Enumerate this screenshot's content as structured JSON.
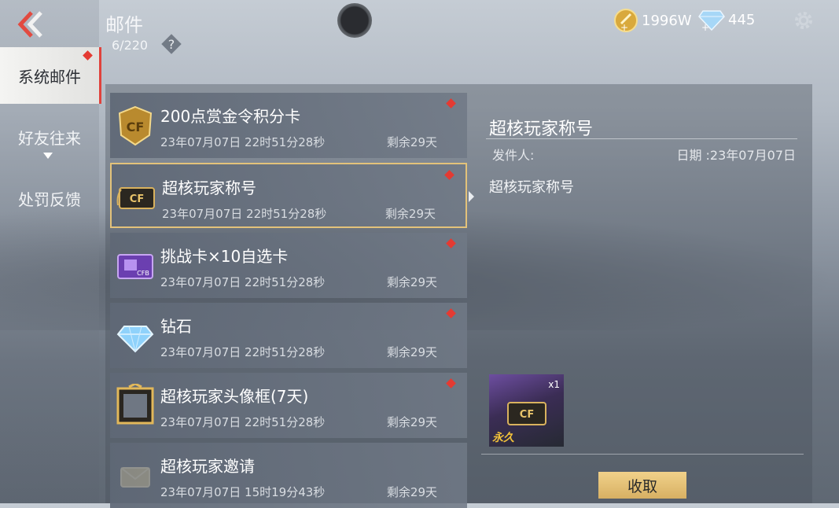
{
  "header": {
    "back_icon": "back-chevron-icon",
    "title": "邮件",
    "mail_count": "6/220",
    "help_icon": "question-icon",
    "currencies": [
      {
        "icon": "gold-coin-icon",
        "value": "1996W"
      },
      {
        "icon": "diamond-icon",
        "value": "445"
      }
    ],
    "settings_icon": "gear-icon"
  },
  "sidebar": {
    "tabs": [
      {
        "label": "系统邮件",
        "active": true
      },
      {
        "label": "好友往来",
        "active": false
      },
      {
        "label": "处罚反馈",
        "active": false
      }
    ]
  },
  "mails": [
    {
      "name": "200点赏金令积分卡",
      "date": "23年07月07日 22时51分28秒",
      "remain": "剩余29天",
      "icon": "bounty-card-icon",
      "unread": true
    },
    {
      "name": "超核玩家称号",
      "date": "23年07月07日 22时51分28秒",
      "remain": "剩余29天",
      "icon": "title-badge-icon",
      "unread": true,
      "selected": true
    },
    {
      "name": "挑战卡×10自选卡",
      "date": "23年07月07日 22时51分28秒",
      "remain": "剩余29天",
      "icon": "challenge-card-icon",
      "unread": true
    },
    {
      "name": "钻石",
      "date": "23年07月07日 22时51分28秒",
      "remain": "剩余29天",
      "icon": "diamond-icon",
      "unread": true
    },
    {
      "name": "超核玩家头像框(7天)",
      "date": "23年07月07日 22时51分28秒",
      "remain": "剩余29天",
      "icon": "avatar-frame-icon",
      "unread": true
    },
    {
      "name": "超核玩家邀请",
      "date": "23年07月07日 15时19分43秒",
      "remain": "剩余29天",
      "icon": "mail-envelope-icon",
      "unread": false
    }
  ],
  "detail": {
    "title": "超核玩家称号",
    "sender_label": "发件人:",
    "date_label": "日期 :23年07月07日",
    "body": "超核玩家称号",
    "attachment": {
      "qty": "x1",
      "tag": "永久",
      "icon": "title-badge-icon"
    },
    "claim_label": "收取"
  },
  "colors": {
    "accent": "#e3c27a",
    "unread_dot": "#e43a32",
    "claim": "#e0bf75"
  }
}
